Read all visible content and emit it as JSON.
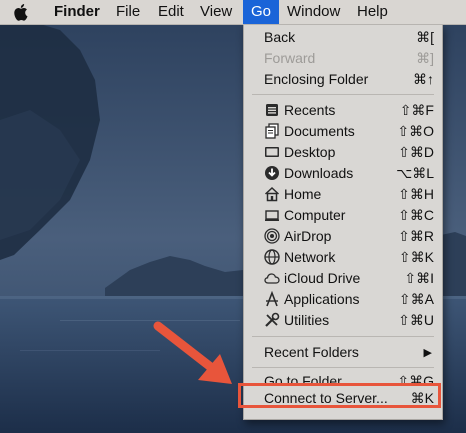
{
  "menubar": {
    "apple_icon": "apple-logo-icon",
    "items": [
      {
        "label": "Finder"
      },
      {
        "label": "File"
      },
      {
        "label": "Edit"
      },
      {
        "label": "View"
      },
      {
        "label": "Go"
      },
      {
        "label": "Window"
      },
      {
        "label": "Help"
      }
    ],
    "active_item": "Go",
    "active_color": "#1a64d8"
  },
  "go_menu": {
    "items": [
      {
        "label": "Back",
        "shortcut": "⌘[",
        "enabled": true
      },
      {
        "label": "Forward",
        "shortcut": "⌘]",
        "enabled": false
      },
      {
        "label": "Enclosing Folder",
        "shortcut": "⌘↑",
        "enabled": true
      },
      {
        "label": "Recents",
        "shortcut": "⇧⌘F",
        "icon": "recents-icon"
      },
      {
        "label": "Documents",
        "shortcut": "⇧⌘O",
        "icon": "documents-icon"
      },
      {
        "label": "Desktop",
        "shortcut": "⇧⌘D",
        "icon": "desktop-icon"
      },
      {
        "label": "Downloads",
        "shortcut": "⌥⌘L",
        "icon": "downloads-icon"
      },
      {
        "label": "Home",
        "shortcut": "⇧⌘H",
        "icon": "home-icon"
      },
      {
        "label": "Computer",
        "shortcut": "⇧⌘C",
        "icon": "computer-icon"
      },
      {
        "label": "AirDrop",
        "shortcut": "⇧⌘R",
        "icon": "airdrop-icon"
      },
      {
        "label": "Network",
        "shortcut": "⇧⌘K",
        "icon": "network-icon"
      },
      {
        "label": "iCloud Drive",
        "shortcut": "⇧⌘I",
        "icon": "icloud-icon"
      },
      {
        "label": "Applications",
        "shortcut": "⇧⌘A",
        "icon": "applications-icon"
      },
      {
        "label": "Utilities",
        "shortcut": "⇧⌘U",
        "icon": "utilities-icon"
      },
      {
        "label": "Recent Folders",
        "shortcut": "▶"
      },
      {
        "label": "Go to Folder...",
        "shortcut": "⇧⌘G"
      },
      {
        "label": "Connect to Server...",
        "shortcut": "⌘K"
      }
    ]
  },
  "annotation": {
    "highlight_target": "Connect to Server...",
    "arrow_color": "#e8553b"
  }
}
